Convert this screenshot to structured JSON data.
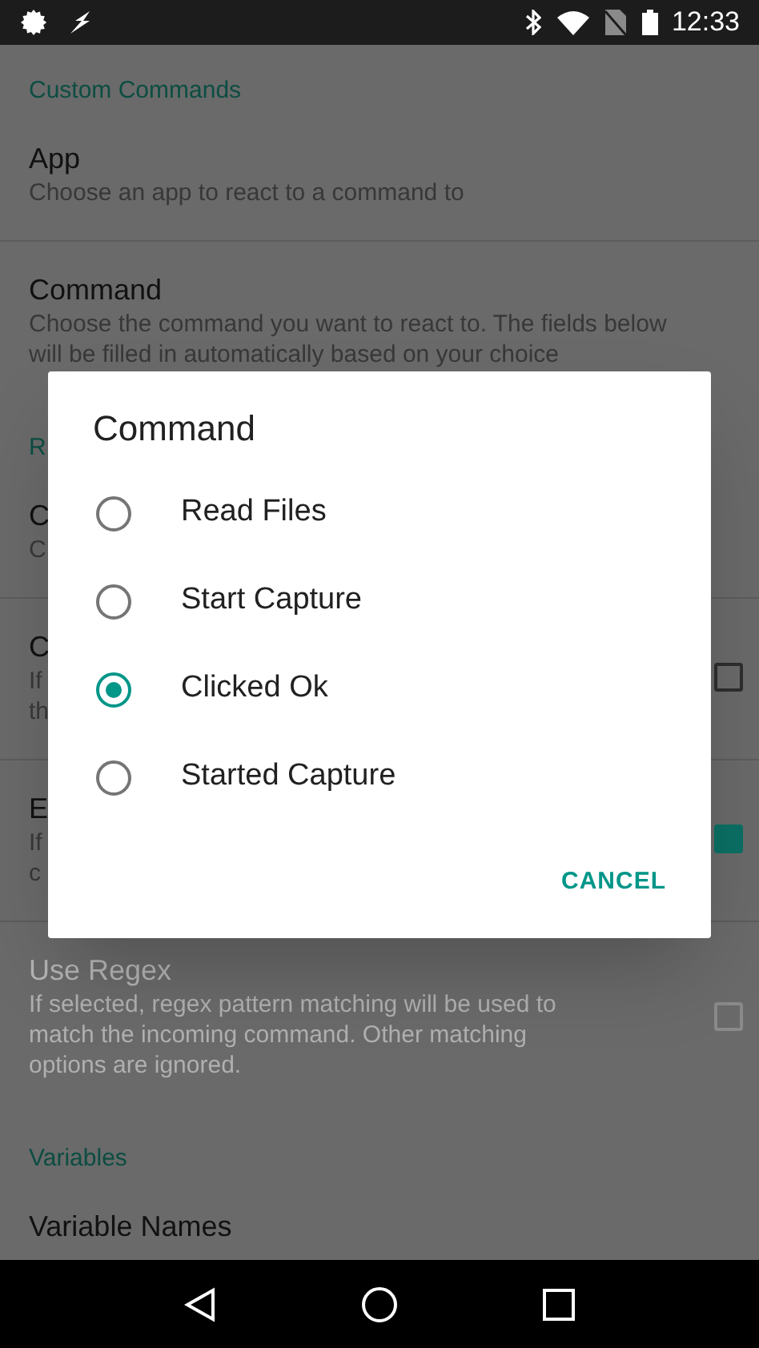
{
  "status_bar": {
    "time": "12:33"
  },
  "sections": [
    {
      "header": "Custom Commands",
      "rows": [
        {
          "title": "App",
          "summary_lines": [
            "Choose an app to react to a command to"
          ]
        },
        {
          "title": "Command",
          "summary_lines": [
            "Choose the command you want to react to. The fields below",
            "will be filled in automatically based on your choice"
          ]
        }
      ]
    },
    {
      "header": "R",
      "rows": [
        {
          "title": "C",
          "summary_lines": [
            "C"
          ]
        },
        {
          "title": "C",
          "summary_lines": [
            "If",
            "th"
          ],
          "checked": false
        },
        {
          "title": "E",
          "summary_lines": [
            "If",
            "c"
          ],
          "checked": true
        },
        {
          "title": "Use Regex",
          "summary_lines": [
            "If selected, regex pattern matching will be used to",
            "match the incoming command. Other matching",
            "options are ignored."
          ],
          "checked": false,
          "disabled": true
        }
      ]
    },
    {
      "header": "Variables",
      "rows": [
        {
          "title": "Variable Names",
          "summary_lines": []
        }
      ]
    }
  ],
  "dialog": {
    "title": "Command",
    "options": [
      {
        "label": "Read Files",
        "selected": false
      },
      {
        "label": "Start Capture",
        "selected": false
      },
      {
        "label": "Clicked Ok",
        "selected": true
      },
      {
        "label": "Started Capture",
        "selected": false
      }
    ],
    "button": "CANCEL"
  }
}
